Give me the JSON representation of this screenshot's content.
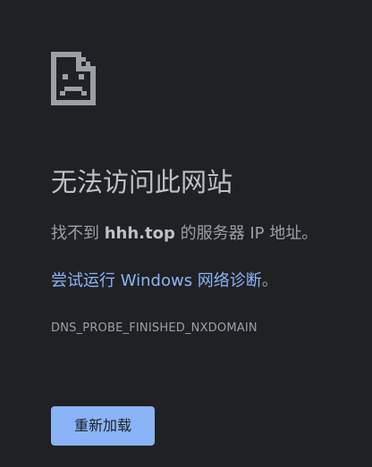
{
  "icon": "sad-page-icon",
  "title": "无法访问此网站",
  "detail": {
    "prefix": "找不到 ",
    "domain": "hhh.top",
    "suffix": " 的服务器 IP 地址。"
  },
  "suggestion": {
    "prefix": "尝试",
    "link": "运行 Windows 网络诊断",
    "suffix": "。"
  },
  "error_code": "DNS_PROBE_FINISHED_NXDOMAIN",
  "reload_button": "重新加载",
  "colors": {
    "background": "#202124",
    "title": "#bdc1c6",
    "body_text": "#9aa0a6",
    "link": "#8ab4f8",
    "button_bg": "#8ab4f8",
    "button_text": "#202124"
  }
}
